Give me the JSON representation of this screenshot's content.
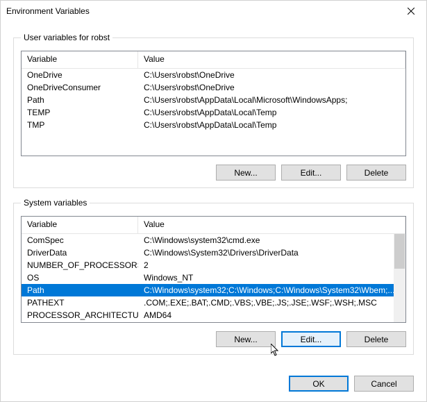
{
  "window": {
    "title": "Environment Variables"
  },
  "userGroup": {
    "legend": "User variables for robst",
    "headers": {
      "variable": "Variable",
      "value": "Value"
    },
    "rows": [
      {
        "variable": "OneDrive",
        "value": "C:\\Users\\robst\\OneDrive"
      },
      {
        "variable": "OneDriveConsumer",
        "value": "C:\\Users\\robst\\OneDrive"
      },
      {
        "variable": "Path",
        "value": "C:\\Users\\robst\\AppData\\Local\\Microsoft\\WindowsApps;"
      },
      {
        "variable": "TEMP",
        "value": "C:\\Users\\robst\\AppData\\Local\\Temp"
      },
      {
        "variable": "TMP",
        "value": "C:\\Users\\robst\\AppData\\Local\\Temp"
      }
    ],
    "buttons": {
      "new": "New...",
      "edit": "Edit...",
      "delete": "Delete"
    }
  },
  "systemGroup": {
    "legend": "System variables",
    "headers": {
      "variable": "Variable",
      "value": "Value"
    },
    "rows": [
      {
        "variable": "ComSpec",
        "value": "C:\\Windows\\system32\\cmd.exe"
      },
      {
        "variable": "DriverData",
        "value": "C:\\Windows\\System32\\Drivers\\DriverData"
      },
      {
        "variable": "NUMBER_OF_PROCESSORS",
        "value": "2"
      },
      {
        "variable": "OS",
        "value": "Windows_NT"
      },
      {
        "variable": "Path",
        "value": "C:\\Windows\\system32;C:\\Windows;C:\\Windows\\System32\\Wbem;..."
      },
      {
        "variable": "PATHEXT",
        "value": ".COM;.EXE;.BAT;.CMD;.VBS;.VBE;.JS;.JSE;.WSF;.WSH;.MSC"
      },
      {
        "variable": "PROCESSOR_ARCHITECTURE",
        "value": "AMD64"
      }
    ],
    "selectedIndex": 4,
    "buttons": {
      "new": "New...",
      "edit": "Edit...",
      "delete": "Delete"
    }
  },
  "dialogButtons": {
    "ok": "OK",
    "cancel": "Cancel"
  }
}
